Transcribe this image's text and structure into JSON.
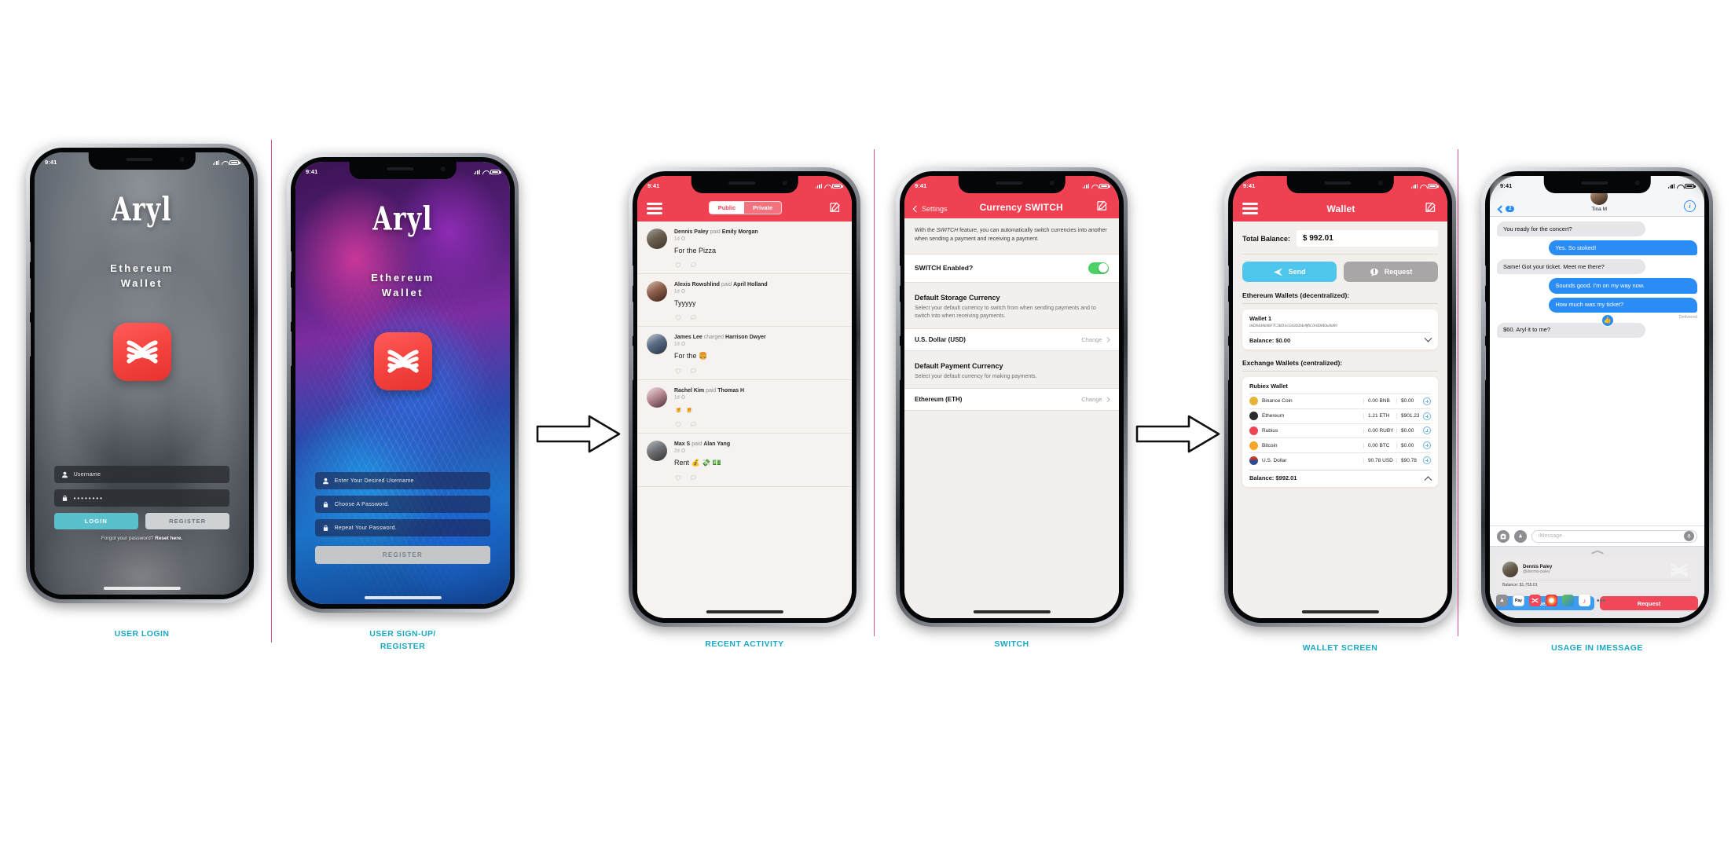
{
  "meta": {
    "status_time": "9:41"
  },
  "screens": [
    {
      "id": "user-login",
      "caption": "USER LOGIN",
      "brand": "Aryl",
      "subtitle_line1": "Ethereum",
      "subtitle_line2": "Wallet",
      "username_placeholder": "Username",
      "password_value": "••••••••",
      "login_label": "LOGIN",
      "register_label": "REGISTER",
      "forgot_prefix": "Forgot your password? ",
      "forgot_link": "Reset here."
    },
    {
      "id": "user-signup",
      "caption_line1": "USER SIGN-UP/",
      "caption_line2": "REGISTER",
      "brand": "Aryl",
      "subtitle_line1": "Ethereum",
      "subtitle_line2": "Wallet",
      "field_username": "Enter Your Desired Username",
      "field_password": "Choose A Password.",
      "field_repeat": "Repeat Your Password.",
      "register_label": "REGISTER"
    },
    {
      "id": "recent-activity",
      "caption": "RECENT ACTIVITY",
      "segment": {
        "public": "Public",
        "private": "Private",
        "selected": "Public"
      },
      "feed": [
        {
          "actor": "Dennis Paley",
          "verb": "paid",
          "target": "Emily Morgan",
          "time": "1d",
          "message": "For the Pizza"
        },
        {
          "actor": "Alexis Rowshlind",
          "verb": "paid",
          "target": "April Holland",
          "time": "1d",
          "message": "Tyyyyy"
        },
        {
          "actor": "James Lee",
          "verb": "charged",
          "target": "Harrison Dwyer",
          "time": "1d",
          "message": "For the 🍔"
        },
        {
          "actor": "Rachel Kim",
          "verb": "paid",
          "target": "Thomas H",
          "time": "1d",
          "message": "🍺 🍺"
        },
        {
          "actor": "Max S",
          "verb": "paid",
          "target": "Alan Yang",
          "time": "2d",
          "message": "Rent 💰 💸 💵"
        }
      ]
    },
    {
      "id": "switch",
      "caption": "SWITCH",
      "back_label": "Settings",
      "title": "Currency SWITCH",
      "description_pre": "With the ",
      "description_em": "SWITCH",
      "description_post": " feature, you can automatically switch currencies into another when sending a payment and receiving a payment.",
      "toggle_label": "SWITCH Enabled?",
      "toggle_on": true,
      "groups": [
        {
          "heading": "Default Storage Currency",
          "desc": "Select your default currency to switch from when sending payments and to switch into when receiving payments.",
          "value": "U.S. Dollar (USD)",
          "action": "Change"
        },
        {
          "heading": "Default Payment Currency",
          "desc": "Select your default currency for making payments.",
          "value": "Ethereum (ETH)",
          "action": "Change"
        }
      ]
    },
    {
      "id": "wallet",
      "caption": "WALLET SCREEN",
      "title": "Wallet",
      "balance_label": "Total Balance:",
      "balance_value": "$ 992.01",
      "send_label": "Send",
      "request_label": "Request",
      "eth_section": "Ethereum Wallets (decentralized):",
      "eth_wallet": {
        "name": "Wallet 1",
        "address": "0xD644A046F7C36D1e3343DD4e9f6C0c6D0Eba9d09",
        "balance": "Balance: $0.00"
      },
      "exchange_section": "Exchange Wallets (centralized):",
      "exchange_wallet": {
        "name": "Rubiex Wallet",
        "rows": [
          {
            "coin": "Binance Coin",
            "amount": "0.00 BNB",
            "usd": "$0.00",
            "color": "#e8b339"
          },
          {
            "coin": "Ethereum",
            "amount": "1.21 ETH",
            "usd": "$901.23",
            "color": "#2b2b2b"
          },
          {
            "coin": "Rubius",
            "amount": "0.00 RUBY",
            "usd": "$0.00",
            "color": "#ef4455"
          },
          {
            "coin": "Bitcoin",
            "amount": "0.00 BTC",
            "usd": "$0.00",
            "color": "#f5a623"
          },
          {
            "coin": "U.S. Dollar",
            "amount": "90.78 USD",
            "usd": "$90.78",
            "color": "#c0392b"
          }
        ],
        "total": "Balance: $992.01"
      }
    },
    {
      "id": "imessage",
      "caption": "USAGE IN IMESSAGE",
      "back_badge": "2",
      "contact": "Tina M",
      "messages": [
        {
          "from": "them",
          "text": "You ready for the concert?"
        },
        {
          "from": "me",
          "text": "Yes. So stoked!"
        },
        {
          "from": "them",
          "text": "Same! Got your ticket. Meet me there?"
        },
        {
          "from": "me",
          "text": "Sounds good. I'm on my way now."
        },
        {
          "from": "me",
          "text": "How much was my ticket?"
        },
        {
          "from": "them",
          "text": "$60. Aryl it to me?"
        }
      ],
      "delivered_label": "Delivered",
      "tapback": "👍",
      "input_placeholder": "iMessage",
      "app_card": {
        "name": "Dennis Paley",
        "handle": "@dennis-paley",
        "balance": "Balance: $1,755.01"
      },
      "send_label": "Send",
      "request_label": "Request"
    }
  ],
  "colors": {
    "brand_red": "#f04152",
    "accent_teal": "#1aa8c4",
    "imessage_blue": "#2a8cf5",
    "send_blue": "#4fc7ed",
    "toggle_green": "#4cd264"
  }
}
